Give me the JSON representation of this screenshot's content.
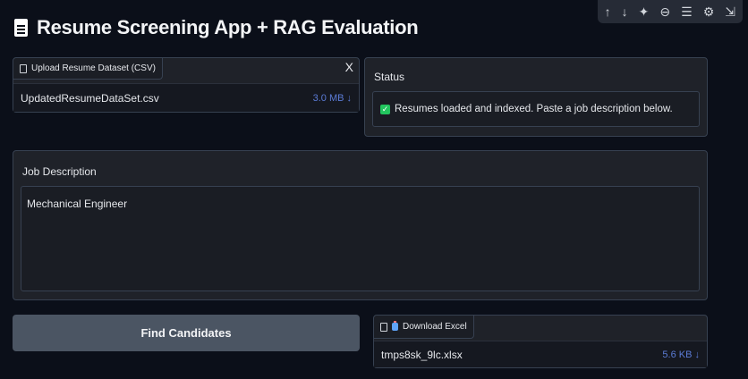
{
  "toolbar_icons": [
    "arrow-up-icon",
    "arrow-down-icon",
    "sparkle-icon",
    "link-icon",
    "notes-icon",
    "gear-icon",
    "share-icon"
  ],
  "title": "Resume Screening App + RAG Evaluation",
  "upload": {
    "label": "Upload Resume Dataset (CSV)",
    "close": "X",
    "file_name": "UpdatedResumeDataSet.csv",
    "file_size": "3.0 MB ↓"
  },
  "status": {
    "label": "Status",
    "message": "Resumes loaded and indexed. Paste a job description below."
  },
  "job_description": {
    "label": "Job Description",
    "value": "Mechanical Engineer"
  },
  "find_button": "Find Candidates",
  "download": {
    "label": "Download Excel",
    "file_name": "tmps8sk_9lc.xlsx",
    "file_size": "5.6 KB ↓"
  },
  "colors": {
    "background": "#0b0f19",
    "panel": "#1f2229",
    "button": "#4b5563",
    "success": "#22c55e",
    "link": "#5b7bd5"
  }
}
